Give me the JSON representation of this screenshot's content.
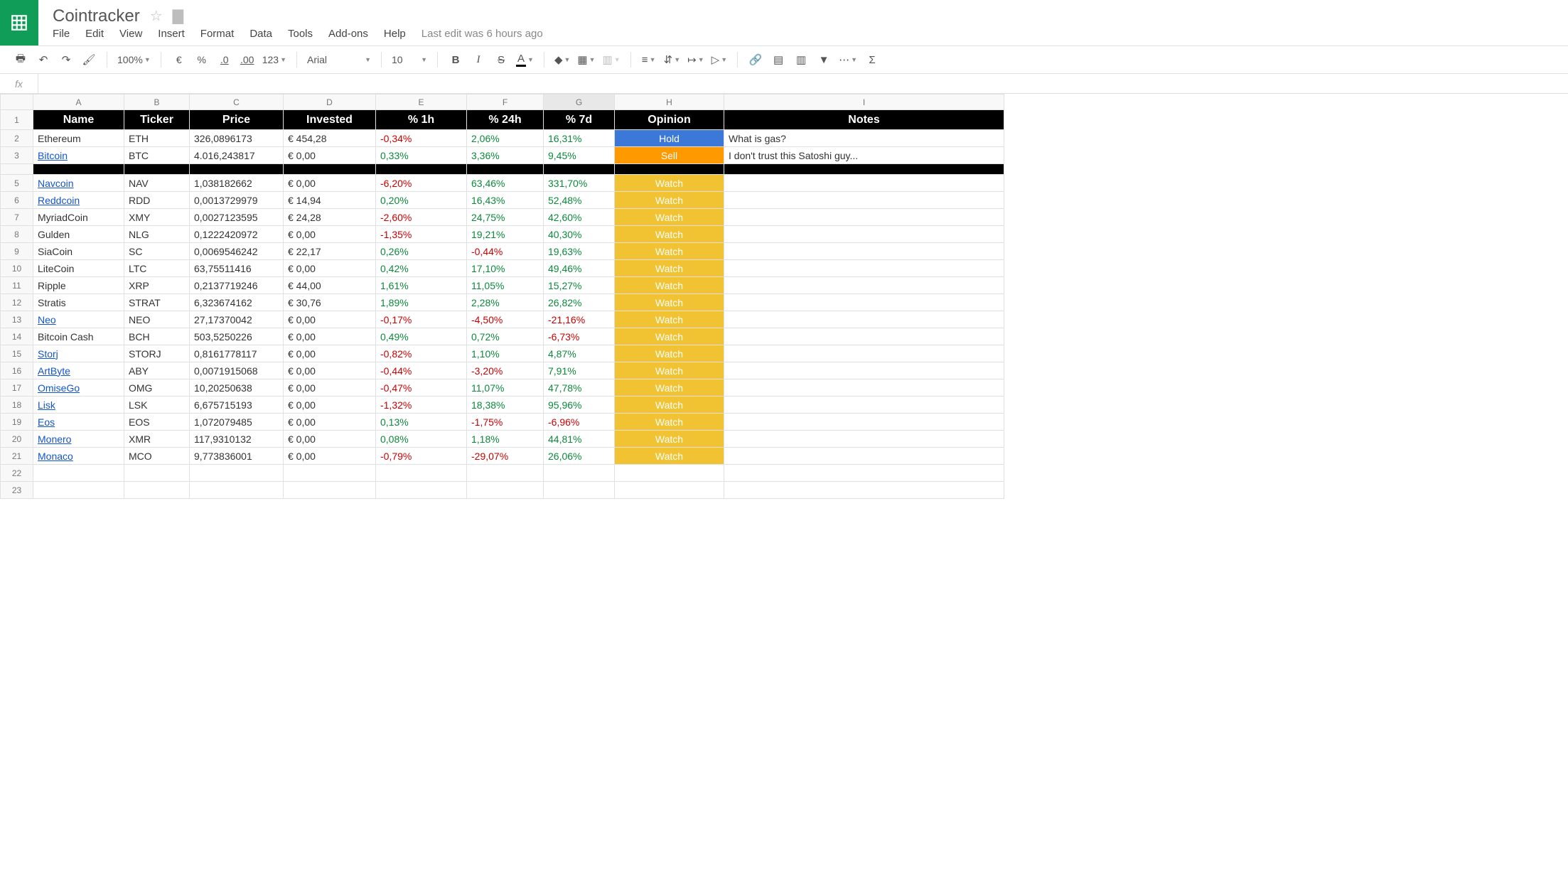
{
  "doc": {
    "title": "Cointracker",
    "last_edit": "Last edit was 6 hours ago"
  },
  "menu": [
    "File",
    "Edit",
    "View",
    "Insert",
    "Format",
    "Data",
    "Tools",
    "Add-ons",
    "Help"
  ],
  "toolbar": {
    "zoom": "100%",
    "currency": "€",
    "percent": "%",
    "dec_dec": ".0",
    "dec_inc": ".00",
    "more_fmt": "123",
    "font": "Arial",
    "font_size": "10"
  },
  "columns": [
    "A",
    "B",
    "C",
    "D",
    "E",
    "F",
    "G",
    "H",
    "I"
  ],
  "selected_column": "G",
  "headers": [
    "Name",
    "Ticker",
    "Price",
    "Invested",
    "% 1h",
    "% 24h",
    "% 7d",
    "Opinion",
    "Notes"
  ],
  "chart_data": {
    "type": "table",
    "columns": [
      "Name",
      "Ticker",
      "Price",
      "Invested",
      "% 1h",
      "% 24h",
      "% 7d",
      "Opinion",
      "Notes"
    ],
    "rows": [
      {
        "row": 2,
        "name": "Ethereum",
        "link": false,
        "ticker": "ETH",
        "price": "326,0896173",
        "invested": "€ 454,28",
        "h1": "-0,34%",
        "h24": "2,06%",
        "d7": "16,31%",
        "opinion": "Hold",
        "notes": "What is gas?"
      },
      {
        "row": 3,
        "name": "Bitcoin",
        "link": true,
        "ticker": "BTC",
        "price": "4.016,243817",
        "invested": "€ 0,00",
        "h1": "0,33%",
        "h24": "3,36%",
        "d7": "9,45%",
        "opinion": "Sell",
        "notes": "I don't trust this Satoshi guy..."
      },
      {
        "row": 5,
        "name": "Navcoin",
        "link": true,
        "ticker": "NAV",
        "price": "1,038182662",
        "invested": "€ 0,00",
        "h1": "-6,20%",
        "h24": "63,46%",
        "d7": "331,70%",
        "opinion": "Watch",
        "notes": ""
      },
      {
        "row": 6,
        "name": "Reddcoin",
        "link": true,
        "ticker": "RDD",
        "price": "0,0013729979",
        "invested": "€ 14,94",
        "h1": "0,20%",
        "h24": "16,43%",
        "d7": "52,48%",
        "opinion": "Watch",
        "notes": ""
      },
      {
        "row": 7,
        "name": "MyriadCoin",
        "link": false,
        "ticker": "XMY",
        "price": "0,0027123595",
        "invested": "€ 24,28",
        "h1": "-2,60%",
        "h24": "24,75%",
        "d7": "42,60%",
        "opinion": "Watch",
        "notes": ""
      },
      {
        "row": 8,
        "name": "Gulden",
        "link": false,
        "ticker": "NLG",
        "price": "0,1222420972",
        "invested": "€ 0,00",
        "h1": "-1,35%",
        "h24": "19,21%",
        "d7": "40,30%",
        "opinion": "Watch",
        "notes": ""
      },
      {
        "row": 9,
        "name": "SiaCoin",
        "link": false,
        "ticker": "SC",
        "price": "0,0069546242",
        "invested": "€ 22,17",
        "h1": "0,26%",
        "h24": "-0,44%",
        "d7": "19,63%",
        "opinion": "Watch",
        "notes": ""
      },
      {
        "row": 10,
        "name": "LiteCoin",
        "link": false,
        "ticker": "LTC",
        "price": "63,75511416",
        "invested": "€ 0,00",
        "h1": "0,42%",
        "h24": "17,10%",
        "d7": "49,46%",
        "opinion": "Watch",
        "notes": ""
      },
      {
        "row": 11,
        "name": "Ripple",
        "link": false,
        "ticker": "XRP",
        "price": "0,2137719246",
        "invested": "€ 44,00",
        "h1": "1,61%",
        "h24": "11,05%",
        "d7": "15,27%",
        "opinion": "Watch",
        "notes": ""
      },
      {
        "row": 12,
        "name": "Stratis",
        "link": false,
        "ticker": "STRAT",
        "price": "6,323674162",
        "invested": "€ 30,76",
        "h1": "1,89%",
        "h24": "2,28%",
        "d7": "26,82%",
        "opinion": "Watch",
        "notes": ""
      },
      {
        "row": 13,
        "name": "Neo",
        "link": true,
        "ticker": "NEO",
        "price": "27,17370042",
        "invested": "€ 0,00",
        "h1": "-0,17%",
        "h24": "-4,50%",
        "d7": "-21,16%",
        "opinion": "Watch",
        "notes": ""
      },
      {
        "row": 14,
        "name": "Bitcoin Cash",
        "link": false,
        "ticker": "BCH",
        "price": "503,5250226",
        "invested": "€ 0,00",
        "h1": "0,49%",
        "h24": "0,72%",
        "d7": "-6,73%",
        "opinion": "Watch",
        "notes": ""
      },
      {
        "row": 15,
        "name": "Storj",
        "link": true,
        "ticker": "STORJ",
        "price": "0,8161778117",
        "invested": "€ 0,00",
        "h1": "-0,82%",
        "h24": "1,10%",
        "d7": "4,87%",
        "opinion": "Watch",
        "notes": ""
      },
      {
        "row": 16,
        "name": "ArtByte",
        "link": true,
        "ticker": "ABY",
        "price": "0,0071915068",
        "invested": "€ 0,00",
        "h1": "-0,44%",
        "h24": "-3,20%",
        "d7": "7,91%",
        "opinion": "Watch",
        "notes": ""
      },
      {
        "row": 17,
        "name": "OmiseGo",
        "link": true,
        "ticker": "OMG",
        "price": "10,20250638",
        "invested": "€ 0,00",
        "h1": "-0,47%",
        "h24": "11,07%",
        "d7": "47,78%",
        "opinion": "Watch",
        "notes": ""
      },
      {
        "row": 18,
        "name": "Lisk",
        "link": true,
        "ticker": "LSK",
        "price": "6,675715193",
        "invested": "€ 0,00",
        "h1": "-1,32%",
        "h24": "18,38%",
        "d7": "95,96%",
        "opinion": "Watch",
        "notes": ""
      },
      {
        "row": 19,
        "name": "Eos",
        "link": true,
        "ticker": "EOS",
        "price": "1,072079485",
        "invested": "€ 0,00",
        "h1": "0,13%",
        "h24": "-1,75%",
        "d7": "-6,96%",
        "opinion": "Watch",
        "notes": ""
      },
      {
        "row": 20,
        "name": "Monero",
        "link": true,
        "ticker": "XMR",
        "price": "117,9310132",
        "invested": "€ 0,00",
        "h1": "0,08%",
        "h24": "1,18%",
        "d7": "44,81%",
        "opinion": "Watch",
        "notes": ""
      },
      {
        "row": 21,
        "name": "Monaco",
        "link": true,
        "ticker": "MCO",
        "price": "9,773836001",
        "invested": "€ 0,00",
        "h1": "-0,79%",
        "h24": "-29,07%",
        "d7": "26,06%",
        "opinion": "Watch",
        "notes": ""
      }
    ]
  },
  "empty_rows": [
    22,
    23
  ]
}
